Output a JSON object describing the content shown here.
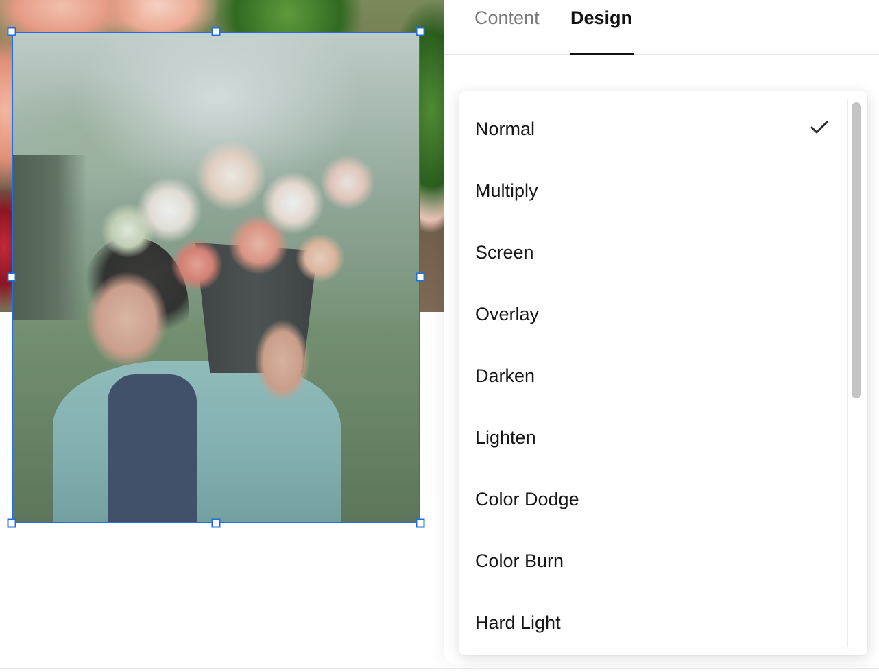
{
  "tabs": [
    {
      "label": "Content",
      "active": false
    },
    {
      "label": "Design",
      "active": true
    }
  ],
  "blend_modes": {
    "selected": "Normal",
    "options": [
      "Normal",
      "Multiply",
      "Screen",
      "Overlay",
      "Darken",
      "Lighten",
      "Color Dodge",
      "Color Burn",
      "Hard Light"
    ]
  },
  "icons": {
    "selected_option": "checkmark-icon"
  },
  "colors": {
    "selection": "#1f6fe0",
    "active_tab": "#111111",
    "inactive_tab": "#7a7a7a"
  }
}
